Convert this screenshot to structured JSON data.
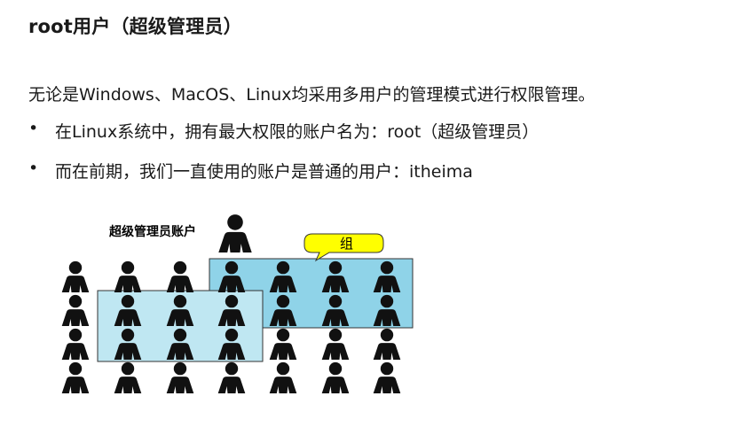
{
  "slide": {
    "title": "root用户（超级管理员）",
    "intro": "无论是Windows、MacOS、Linux均采用多用户的管理模式进行权限管理。",
    "bullets": [
      "在Linux系统中，拥有最大权限的账户名为：root（超级管理员）",
      "而在前期，我们一直使用的账户是普通的用户：itheima"
    ],
    "bullet_symbol": "•"
  },
  "figure": {
    "admin_label": "超级管理员账户",
    "group_label": "组",
    "colors": {
      "person": "#111111",
      "group_box_fill": "#8fd3e8",
      "group_box_stroke": "#333333",
      "overlap_box_fill": "#bfe7f2",
      "callout_fill": "#ffff00"
    }
  }
}
